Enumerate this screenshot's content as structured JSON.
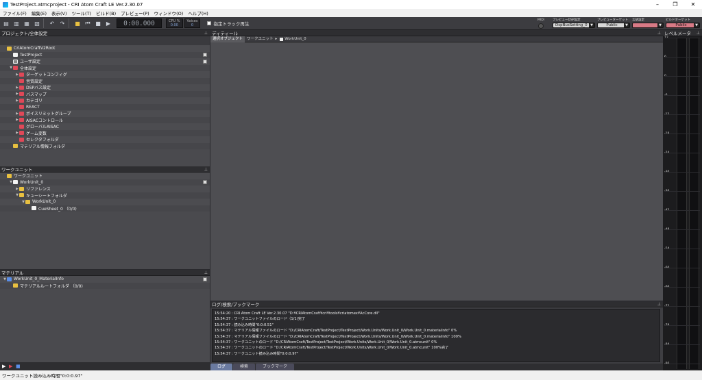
{
  "window": {
    "title": "TestProject.atmcproject - CRI Atom Craft LE Ver.2.30.07",
    "minimize": "–",
    "restore": "❐",
    "close": "✕"
  },
  "menu": [
    "ファイル(F)",
    "編集(E)",
    "表示(V)",
    "ツール(T)",
    "ビルド(B)",
    "プレビュー(P)",
    "ウィンドウ(O)",
    "ヘルプ(H)"
  ],
  "toolbar": {
    "timecode": "0:00.000",
    "cpu_label": "CPU %",
    "cpu_value": "0.00",
    "voices_label": "Voices",
    "voices_value": "0",
    "track_play_label": "指定トラック再生",
    "midi_label": "MIDI",
    "dsp_label": "プレビューDSP設定",
    "dsp_value": "DspBusSetting_0",
    "target_label": "プレビューターゲット",
    "target_value": "Public",
    "lang_label": "言語設定",
    "lang_value": "",
    "build_label": "ビルドターゲット",
    "build_value": "Public",
    "icons": [
      "new-project-icon",
      "open-icon",
      "save-icon",
      "save-all-icon",
      "undo-icon",
      "redo-icon",
      "build-icon",
      "prev-icon",
      "stop-icon",
      "play-icon"
    ]
  },
  "colors": {
    "lang_box": "#d87a86",
    "build_box": "#d87a86",
    "dd_box": "#d8d8d8"
  },
  "project": {
    "header": "プロジェクト/全体設定",
    "items": [
      {
        "label": "CriAtomCraftV2Root",
        "indent": 0,
        "icon": "folder",
        "tri": ""
      },
      {
        "label": "TestProject",
        "indent": 1,
        "icon": "doc",
        "tri": "",
        "btn": true
      },
      {
        "label": "ユーザ設定",
        "indent": 1,
        "icon": "user",
        "tri": "",
        "btn": true
      },
      {
        "label": "全体設定",
        "indent": 1,
        "icon": "red",
        "tri": "▼"
      },
      {
        "label": "ターゲットコンフィグ",
        "indent": 2,
        "icon": "red",
        "tri": "▶"
      },
      {
        "label": "音質設定",
        "indent": 2,
        "icon": "red",
        "tri": ""
      },
      {
        "label": "DSPバス設定",
        "indent": 2,
        "icon": "red",
        "tri": "▶"
      },
      {
        "label": "バスマップ",
        "indent": 2,
        "icon": "red",
        "tri": "▶"
      },
      {
        "label": "カテゴリ",
        "indent": 2,
        "icon": "red",
        "tri": "▶"
      },
      {
        "label": "REACT",
        "indent": 2,
        "icon": "red",
        "tri": ""
      },
      {
        "label": "ボイスリミットグループ",
        "indent": 2,
        "icon": "red",
        "tri": "▶"
      },
      {
        "label": "AISACコントロール",
        "indent": 2,
        "icon": "red",
        "tri": "▶"
      },
      {
        "label": "グローバルAISAC",
        "indent": 2,
        "icon": "red",
        "tri": ""
      },
      {
        "label": "ゲーム変数",
        "indent": 2,
        "icon": "red",
        "tri": "▶"
      },
      {
        "label": "セレクタフォルダ",
        "indent": 2,
        "icon": "red",
        "tri": ""
      },
      {
        "label": "マテリアル情報フォルダ",
        "indent": 1,
        "icon": "folder",
        "tri": ""
      }
    ]
  },
  "workunit": {
    "header": "ワークユニット",
    "items": [
      {
        "label": "ワークユニット",
        "indent": 0,
        "icon": "folder",
        "tri": ""
      },
      {
        "label": "WorkUnit_0",
        "indent": 1,
        "icon": "doc",
        "tri": "▼",
        "btn": true
      },
      {
        "label": "リファレンス",
        "indent": 2,
        "icon": "folder",
        "tri": "▶"
      },
      {
        "label": "キューシートフォルダ",
        "indent": 2,
        "icon": "folder",
        "tri": "▼"
      },
      {
        "label": "WorkUnit_0",
        "indent": 3,
        "icon": "folder",
        "tri": "▼"
      },
      {
        "label": "CueSheet_0 （0/0)",
        "indent": 4,
        "icon": "doc",
        "tri": ""
      }
    ]
  },
  "material": {
    "header": "マテリアル",
    "items": [
      {
        "label": "WorkUnit_0_MaterialInfo",
        "indent": 0,
        "icon": "blue",
        "tri": "▼",
        "btn": true
      },
      {
        "label": "マテリアルルートフォルダ （0/0)",
        "indent": 1,
        "icon": "folder",
        "tri": ""
      }
    ]
  },
  "editor": {
    "header": "ディティール",
    "tabs": [
      "選択オブジェクト",
      "ワークユニット"
    ],
    "crumb_sep": "▸",
    "crumb": "WorkUnit_0"
  },
  "log": {
    "header": "ログ/検索/ブックマーク",
    "lines": [
      "15:54:20 : CRI Atom Craft LE Ver.2.30.07 \"D:¥CRIAtomCraft¥cri¥tools¥criatomex¥AcCore.dll\"",
      "15:54:37 : ワークユニットファイルのロード（1/1)完了",
      "15:54:37 : 読み込み時間\"0:0:0.51\"",
      "15:54:37 : マテリアル情報ファイルのロード \"D:/CRIAtomCraft/TestProject/TestProject/Work.Units/Work.Unit_0/Work.Unit_0.materialinfo\" 0%",
      "15:54:37 : マテリアル情報ファイルのロード \"D:/CRIAtomCraft/TestProject/TestProject/Work.Units/Work.Unit_0/Work.Unit_0.materialinfo\" 100%",
      "15:54:37 : ワークユニットのロード \"D:/CRIAtomCraft/TestProject/TestProject/Work.Units/Work.Unit_0/Work.Unit_0.atmcunit\" 0%",
      "15:54:37 : ワークユニットのロード \"D:/CRIAtomCraft/TestProject/TestProject/Work.Units/Work.Unit_0/Work.Unit_0.atmcunit\" 100%完了",
      "15:54:37 : ワークユニット読み込み時間\"0:0:0.97\""
    ],
    "tabs": [
      "ログ",
      "検索",
      "ブックマーク"
    ]
  },
  "level": {
    "header": "レベルメータ",
    "ticks": [
      "12",
      "6",
      "0",
      "-6",
      "-12",
      "-18",
      "-24",
      "-30",
      "-36",
      "-42",
      "-48",
      "-54",
      "-60",
      "-66",
      "-72",
      "-78",
      "-84",
      "-96"
    ]
  },
  "status": "ワークユニット読み込み時間\"0:0:0.97\""
}
